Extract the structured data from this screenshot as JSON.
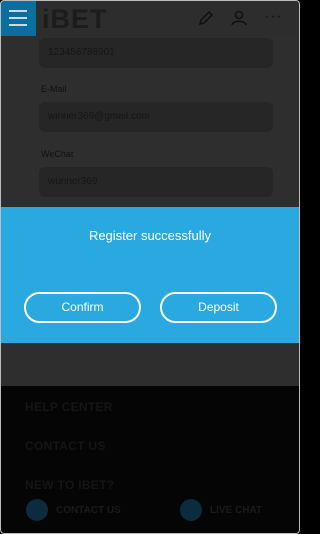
{
  "header": {
    "logo": "iBET",
    "icons": [
      "menu-icon",
      "edit-icon",
      "user-icon",
      "more-icon"
    ],
    "more_glyph": "···"
  },
  "form": {
    "phone_value": "123456788901",
    "email_label": "E-Mail",
    "email_value": "winner369@gmail.com",
    "wechat_label": "WeChat",
    "wechat_value": "wunner369"
  },
  "footer": {
    "links": [
      "HELP CENTER",
      "CONTACT US",
      "NEW TO IBET?"
    ],
    "contact_label": "CONTACT US",
    "livechat_label": "LIVE CHAT"
  },
  "modal": {
    "title": "Register successfully",
    "confirm_label": "Confirm",
    "deposit_label": "Deposit"
  },
  "colors": {
    "modal_bg": "#29a9df",
    "menu_bg": "#0a6f9e"
  }
}
